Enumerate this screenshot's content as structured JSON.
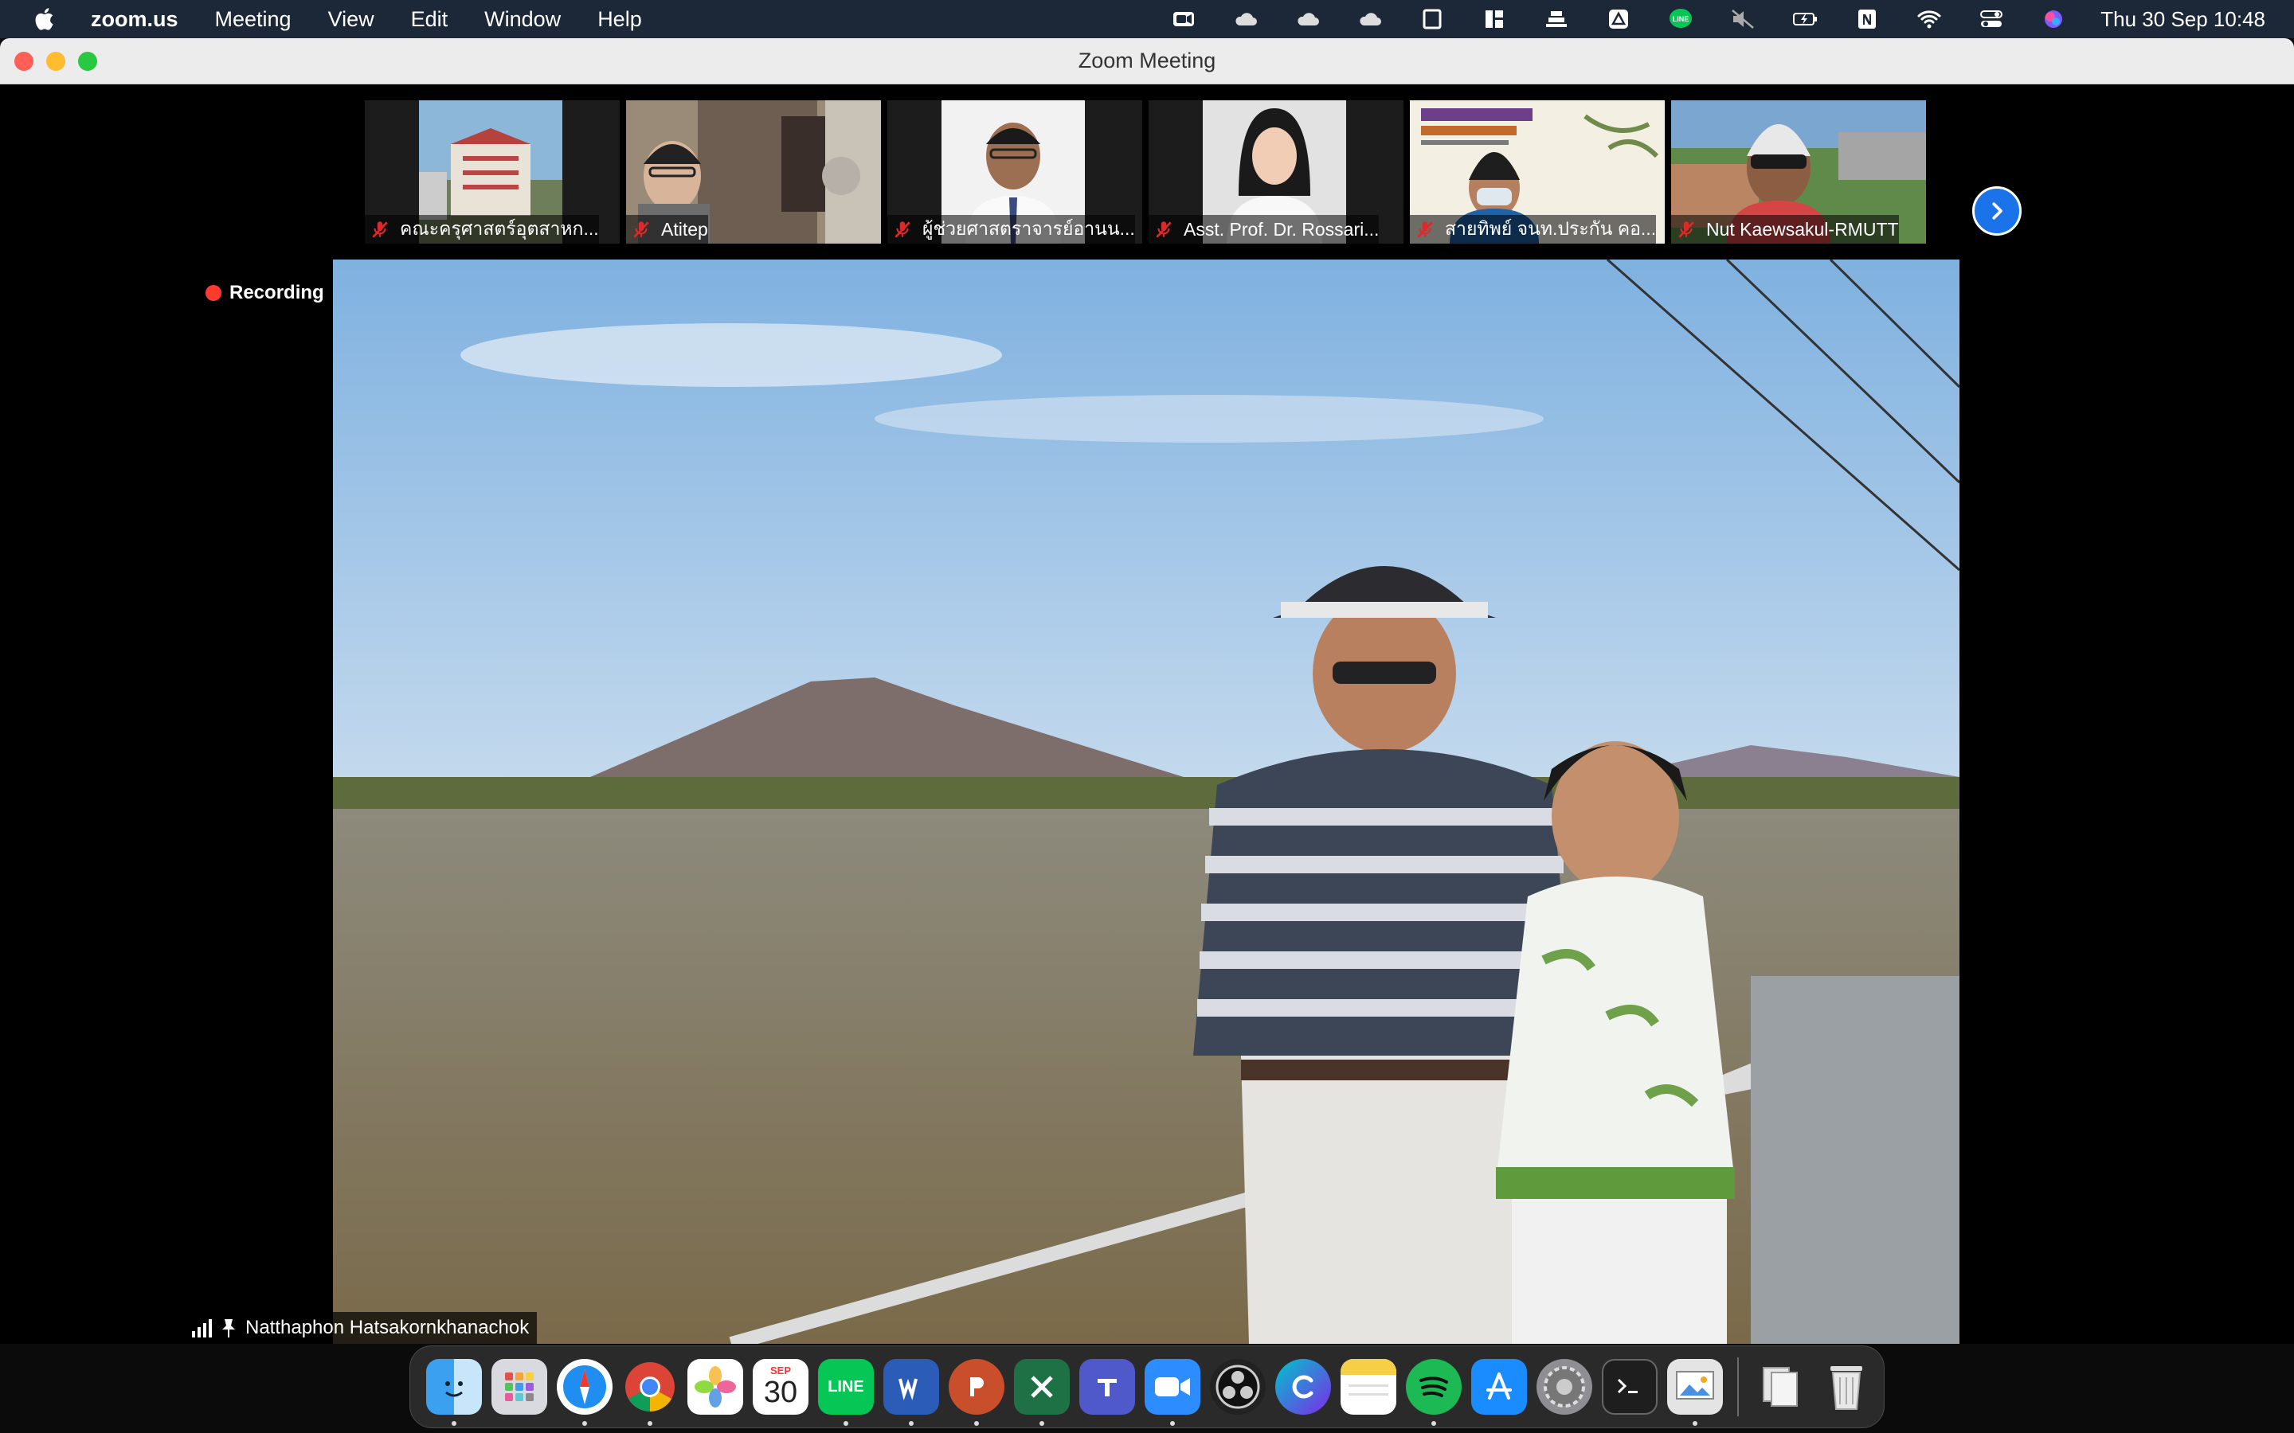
{
  "menubar": {
    "app_name": "zoom.us",
    "menus": [
      "Meeting",
      "View",
      "Edit",
      "Window",
      "Help"
    ],
    "clock": "Thu 30 Sep  10:48"
  },
  "window": {
    "title": "Zoom Meeting"
  },
  "participants": [
    {
      "name": "คณะครุศาสตร์อุตสาหก...",
      "muted": true
    },
    {
      "name": "Atitep",
      "muted": true
    },
    {
      "name": "ผู้ช่วยศาสตราจารย์อานน...",
      "muted": true
    },
    {
      "name": "Asst. Prof. Dr. Rossari...",
      "muted": true
    },
    {
      "name": "สายทิพย์ จนท.ประกัน คอ...",
      "muted": true
    },
    {
      "name": "Nut Kaewsakul-RMUTT",
      "muted": true
    }
  ],
  "main_video": {
    "recording_label": "Recording",
    "speaker_name": "Natthaphon Hatsakornkhanachok"
  },
  "dock": {
    "calendar_month": "SEP",
    "calendar_day": "30",
    "line_label": "LINE"
  },
  "colors": {
    "menubar_bg": "#1c2738",
    "accent_blue": "#1a73e8",
    "recording_red": "#ff3b30",
    "mute_red": "#e02828"
  }
}
